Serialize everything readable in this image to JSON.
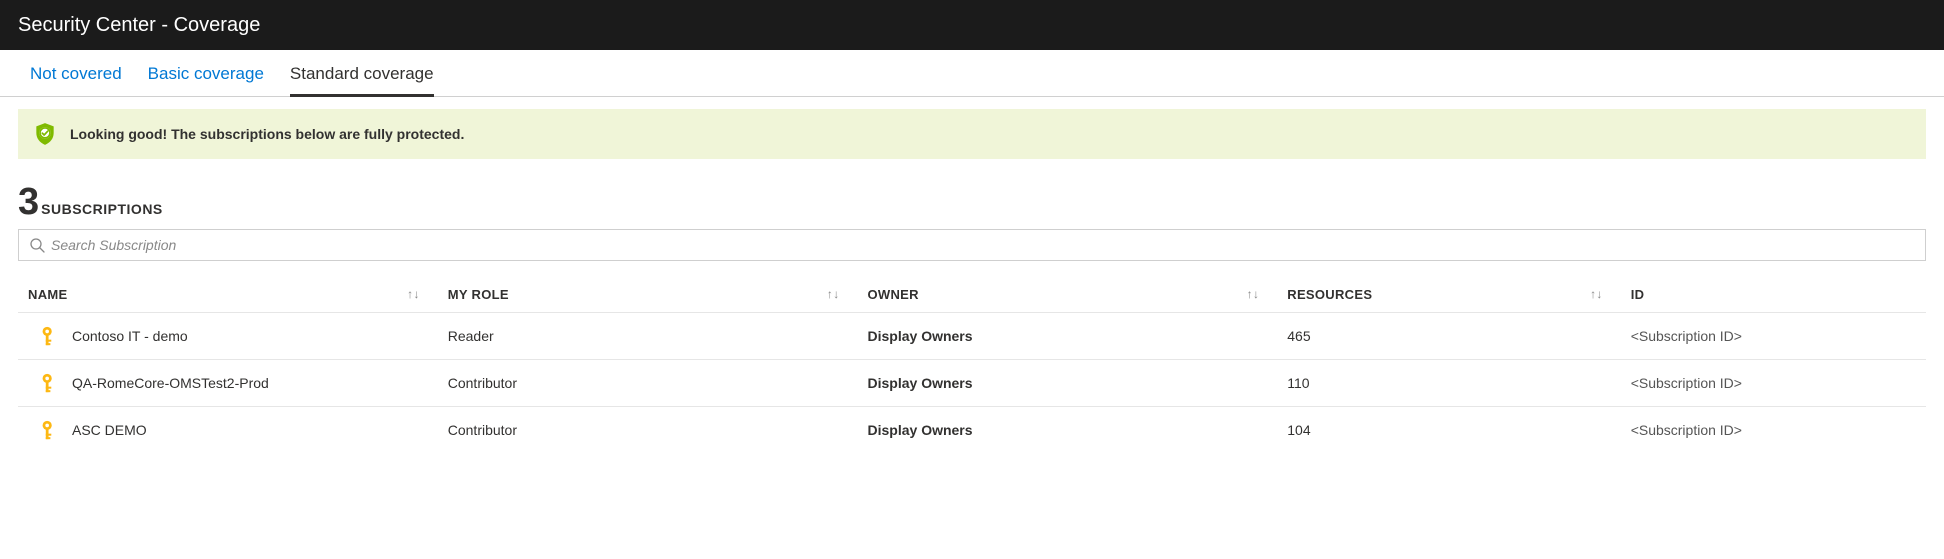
{
  "header": {
    "title": "Security Center - Coverage"
  },
  "tabs": [
    {
      "label": "Not covered",
      "active": false
    },
    {
      "label": "Basic coverage",
      "active": false
    },
    {
      "label": "Standard coverage",
      "active": true
    }
  ],
  "banner": {
    "icon": "shield-check-icon",
    "text": "Looking good! The subscriptions below are fully protected."
  },
  "count": {
    "number": "3",
    "label": "SUBSCRIPTIONS"
  },
  "search": {
    "placeholder": "Search Subscription",
    "value": ""
  },
  "columns": {
    "name": "NAME",
    "role": "MY ROLE",
    "owner": "OWNER",
    "resources": "RESOURCES",
    "id": "ID"
  },
  "rows": [
    {
      "name": "Contoso IT - demo",
      "role": "Reader",
      "owner": "Display Owners",
      "resources": "465",
      "id": "<Subscription ID>"
    },
    {
      "name": "QA-RomeCore-OMSTest2-Prod",
      "role": "Contributor",
      "owner": "Display Owners",
      "resources": "110",
      "id": "<Subscription ID>"
    },
    {
      "name": "ASC DEMO",
      "role": "Contributor",
      "owner": "Display Owners",
      "resources": "104",
      "id": "<Subscription ID>"
    }
  ],
  "colors": {
    "link": "#0078d4",
    "banner_bg": "#f0f5d8",
    "banner_accent": "#7fba00",
    "key": "#fdb813"
  }
}
